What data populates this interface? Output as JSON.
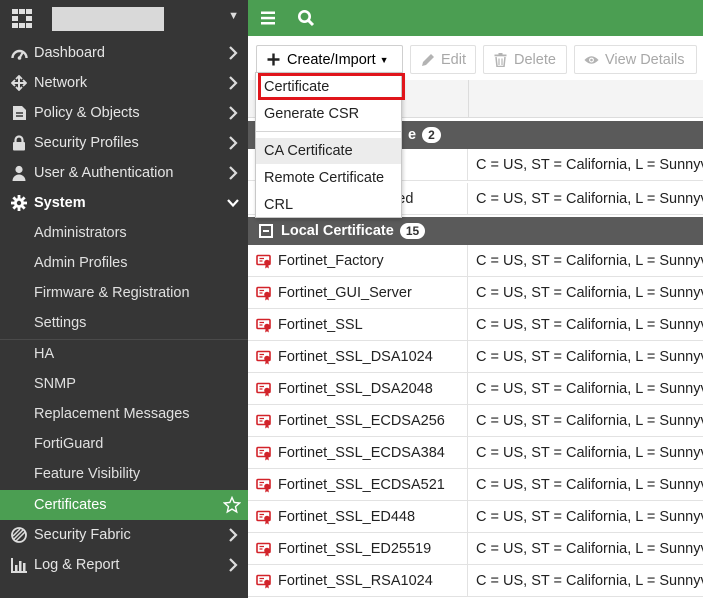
{
  "sidebar": {
    "header": {
      "logo_icon": "fortinet-logo-icon",
      "hostname": ""
    },
    "items": [
      {
        "label": "Dashboard",
        "icon": "dashboard-icon"
      },
      {
        "label": "Network",
        "icon": "network-icon"
      },
      {
        "label": "Policy & Objects",
        "icon": "policy-icon"
      },
      {
        "label": "Security Profiles",
        "icon": "lock-icon"
      },
      {
        "label": "User & Authentication",
        "icon": "user-icon"
      },
      {
        "label": "System",
        "icon": "gear-icon",
        "expanded": true
      }
    ],
    "system_children": [
      "Administrators",
      "Admin Profiles",
      "Firmware & Registration",
      "Settings",
      "HA",
      "SNMP",
      "Replacement Messages",
      "FortiGuard",
      "Feature Visibility",
      "Certificates"
    ],
    "active_item": "Certificates",
    "bottom_items": [
      {
        "label": "Security Fabric",
        "icon": "fabric-icon"
      },
      {
        "label": "Log & Report",
        "icon": "chart-icon"
      }
    ]
  },
  "topbar": {
    "menu_icon": "hamburger-icon",
    "search_icon": "search-icon"
  },
  "toolbar": {
    "create_import": "Create/Import",
    "edit": "Edit",
    "delete": "Delete",
    "view_details": "View Details"
  },
  "dropdown": {
    "items": [
      "Certificate",
      "Generate CSR",
      "CA Certificate",
      "Remote Certificate",
      "CRL"
    ],
    "highlighted": "Certificate",
    "hovered": "CA Certificate"
  },
  "table": {
    "groups": [
      {
        "label_visible": "e",
        "count": "2",
        "rows": [
          {
            "name": "",
            "subject": "C = US, ST = California, L = Sunnyva",
            "dashed": true
          },
          {
            "name": "sted",
            "subject": "C = US, ST = California, L = Sunnyva"
          }
        ]
      },
      {
        "label": "Local Certificate",
        "count": "15",
        "rows": [
          {
            "name": "Fortinet_Factory",
            "subject": "C = US, ST = California, L = Sunnyva"
          },
          {
            "name": "Fortinet_GUI_Server",
            "subject": "C = US, ST = California, L = Sunnyva"
          },
          {
            "name": "Fortinet_SSL",
            "subject": "C = US, ST = California, L = Sunnyva"
          },
          {
            "name": "Fortinet_SSL_DSA1024",
            "subject": "C = US, ST = California, L = Sunnyva"
          },
          {
            "name": "Fortinet_SSL_DSA2048",
            "subject": "C = US, ST = California, L = Sunnyva"
          },
          {
            "name": "Fortinet_SSL_ECDSA256",
            "subject": "C = US, ST = California, L = Sunnyva"
          },
          {
            "name": "Fortinet_SSL_ECDSA384",
            "subject": "C = US, ST = California, L = Sunnyva"
          },
          {
            "name": "Fortinet_SSL_ECDSA521",
            "subject": "C = US, ST = California, L = Sunnyva"
          },
          {
            "name": "Fortinet_SSL_ED448",
            "subject": "C = US, ST = California, L = Sunnyva"
          },
          {
            "name": "Fortinet_SSL_ED25519",
            "subject": "C = US, ST = California, L = Sunnyva"
          },
          {
            "name": "Fortinet_SSL_RSA1024",
            "subject": "C = US, ST = California, L = Sunnyva"
          }
        ]
      }
    ]
  },
  "colors": {
    "sidebar_bg": "#363636",
    "accent_green": "#4b9e52",
    "group_header_bg": "#5a5a5a",
    "highlight_red": "#e0151b",
    "cert_icon_red": "#d2232a"
  }
}
